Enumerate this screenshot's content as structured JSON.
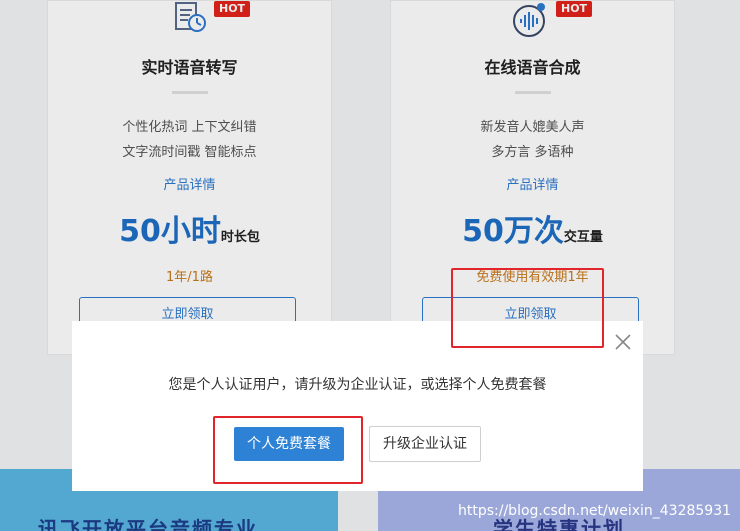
{
  "cards": [
    {
      "badge": "HOT",
      "icon": "document-clock-icon",
      "title": "实时语音转写",
      "features": [
        "个性化热词 上下文纠错",
        "文字流时间戳 智能标点"
      ],
      "details_link": "产品详情",
      "amount_big": "50小时",
      "amount_unit": "时长包",
      "validity": "1年/1路",
      "claim_label": "立即领取"
    },
    {
      "badge": "HOT",
      "icon": "audio-wave-icon",
      "title": "在线语音合成",
      "features": [
        "新发音人媲美人声",
        "多方言 多语种"
      ],
      "details_link": "产品详情",
      "amount_big": "50万次",
      "amount_unit": "交互量",
      "validity": "免费使用有效期1年",
      "claim_label": "立即领取"
    }
  ],
  "modal": {
    "message": "您是个人认证用户，请升级为企业认证，或选择个人免费套餐",
    "primary_label": "个人免费套餐",
    "secondary_label": "升级企业认证",
    "close_icon": "close-icon"
  },
  "banners": {
    "left_text": "讯飞开放平台音频专业",
    "right_text": "学生特惠计划"
  },
  "watermark": "https://blog.csdn.net/weixin_43285931",
  "colors": {
    "accent_blue": "#2e7ad1",
    "primary_button": "#2e82d6",
    "hot_red": "#e2231a",
    "annotation_red": "#e1252a",
    "validity_orange": "#c87a1d"
  }
}
